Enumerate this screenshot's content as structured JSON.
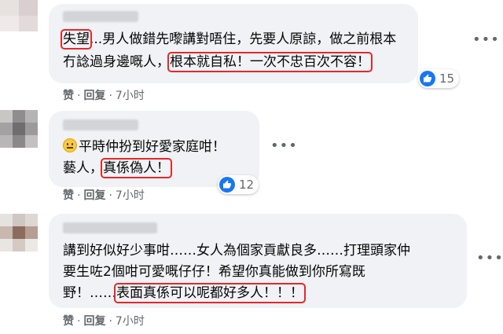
{
  "comments": [
    {
      "line1_prefix": "",
      "line1_hl": "失望",
      "line1_rest": "...男人做錯先嚟講對唔住，先要人原諒，做之前根本",
      "line2_prefix": "冇諗過身邊嘅人，",
      "line2_hl": "根本就自私！一次不忠百次不容！",
      "reaction_count": "15",
      "like_label": "赞",
      "reply_label": "回复",
      "time": "7小时"
    },
    {
      "line1_prefix": "",
      "line1_text": "平時仲扮到好愛家庭咁！",
      "line2_prefix": "藝人，",
      "line2_hl": "真係偽人！",
      "reaction_count": "12",
      "like_label": "赞",
      "reply_label": "回复",
      "time": "7小时"
    },
    {
      "line1_text": "講到好似好少事咁……女人為個家貢獻良多……打理頭家仲",
      "line2_text": "要生咗2個咁可愛嘅仔仔！希望你真能做到你所寫既",
      "line3_prefix": "野！……",
      "line3_hl": "表面真係可以呢都好多人！！！",
      "like_label": "赞",
      "reply_label": "回复",
      "time": "7小时"
    }
  ],
  "icons": {
    "more": "more-dots-icon",
    "like": "thumbs-up-icon",
    "emoji": "neutral-face-icon"
  },
  "colors": {
    "highlight": "#e8262a",
    "bubble": "#f0f2f5",
    "like_blue": "#1877f2",
    "meta": "#65676b"
  }
}
